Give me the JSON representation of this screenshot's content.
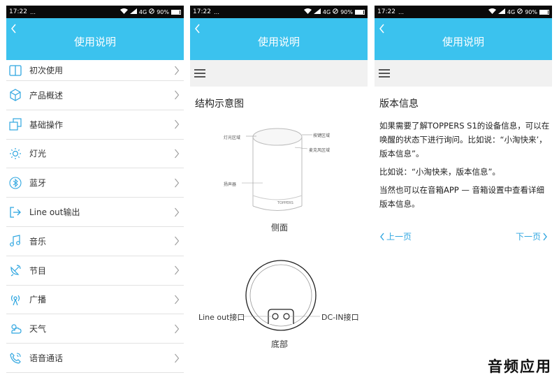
{
  "status_bar": {
    "time": "17:22",
    "dots": "…",
    "network": "4G",
    "battery": "90%"
  },
  "panel1": {
    "title": "使用说明",
    "menu": [
      {
        "label": "初次使用",
        "icon": "book-icon"
      },
      {
        "label": "产品概述",
        "icon": "cube-icon"
      },
      {
        "label": "基础操作",
        "icon": "layers-icon"
      },
      {
        "label": "灯光",
        "icon": "sun-icon"
      },
      {
        "label": "蓝牙",
        "icon": "bluetooth-icon"
      },
      {
        "label": "Line out输出",
        "icon": "export-icon"
      },
      {
        "label": "音乐",
        "icon": "music-note-icon"
      },
      {
        "label": "节目",
        "icon": "satellite-icon"
      },
      {
        "label": "广播",
        "icon": "broadcast-icon"
      },
      {
        "label": "天气",
        "icon": "weather-icon"
      },
      {
        "label": "语音通话",
        "icon": "phone-icon"
      }
    ]
  },
  "panel2": {
    "title": "使用说明",
    "section_title": "结构示意图",
    "labels": {
      "light_area": "灯光区域",
      "button_area": "按键区域",
      "mic_area": "麦克风区域",
      "speaker": "扬声器",
      "brand": "TOPPERS",
      "side_caption": "侧面",
      "line_out": "Line out接口",
      "dc_in": "DC-IN接口",
      "bottom_caption": "底部"
    }
  },
  "panel3": {
    "title": "使用说明",
    "section_title": "版本信息",
    "paragraphs": [
      "如果需要了解TOPPERS S1的设备信息，可以在唤醒的状态下进行询问。比如说：“小淘快来’，版本信息”。",
      "比如说：“小淘快来，版本信息”。",
      "当然也可以在音箱APP — 音箱设置中查看详细版本信息。"
    ],
    "prev": "上一页",
    "next": "下一页"
  },
  "watermark": "音频应用"
}
